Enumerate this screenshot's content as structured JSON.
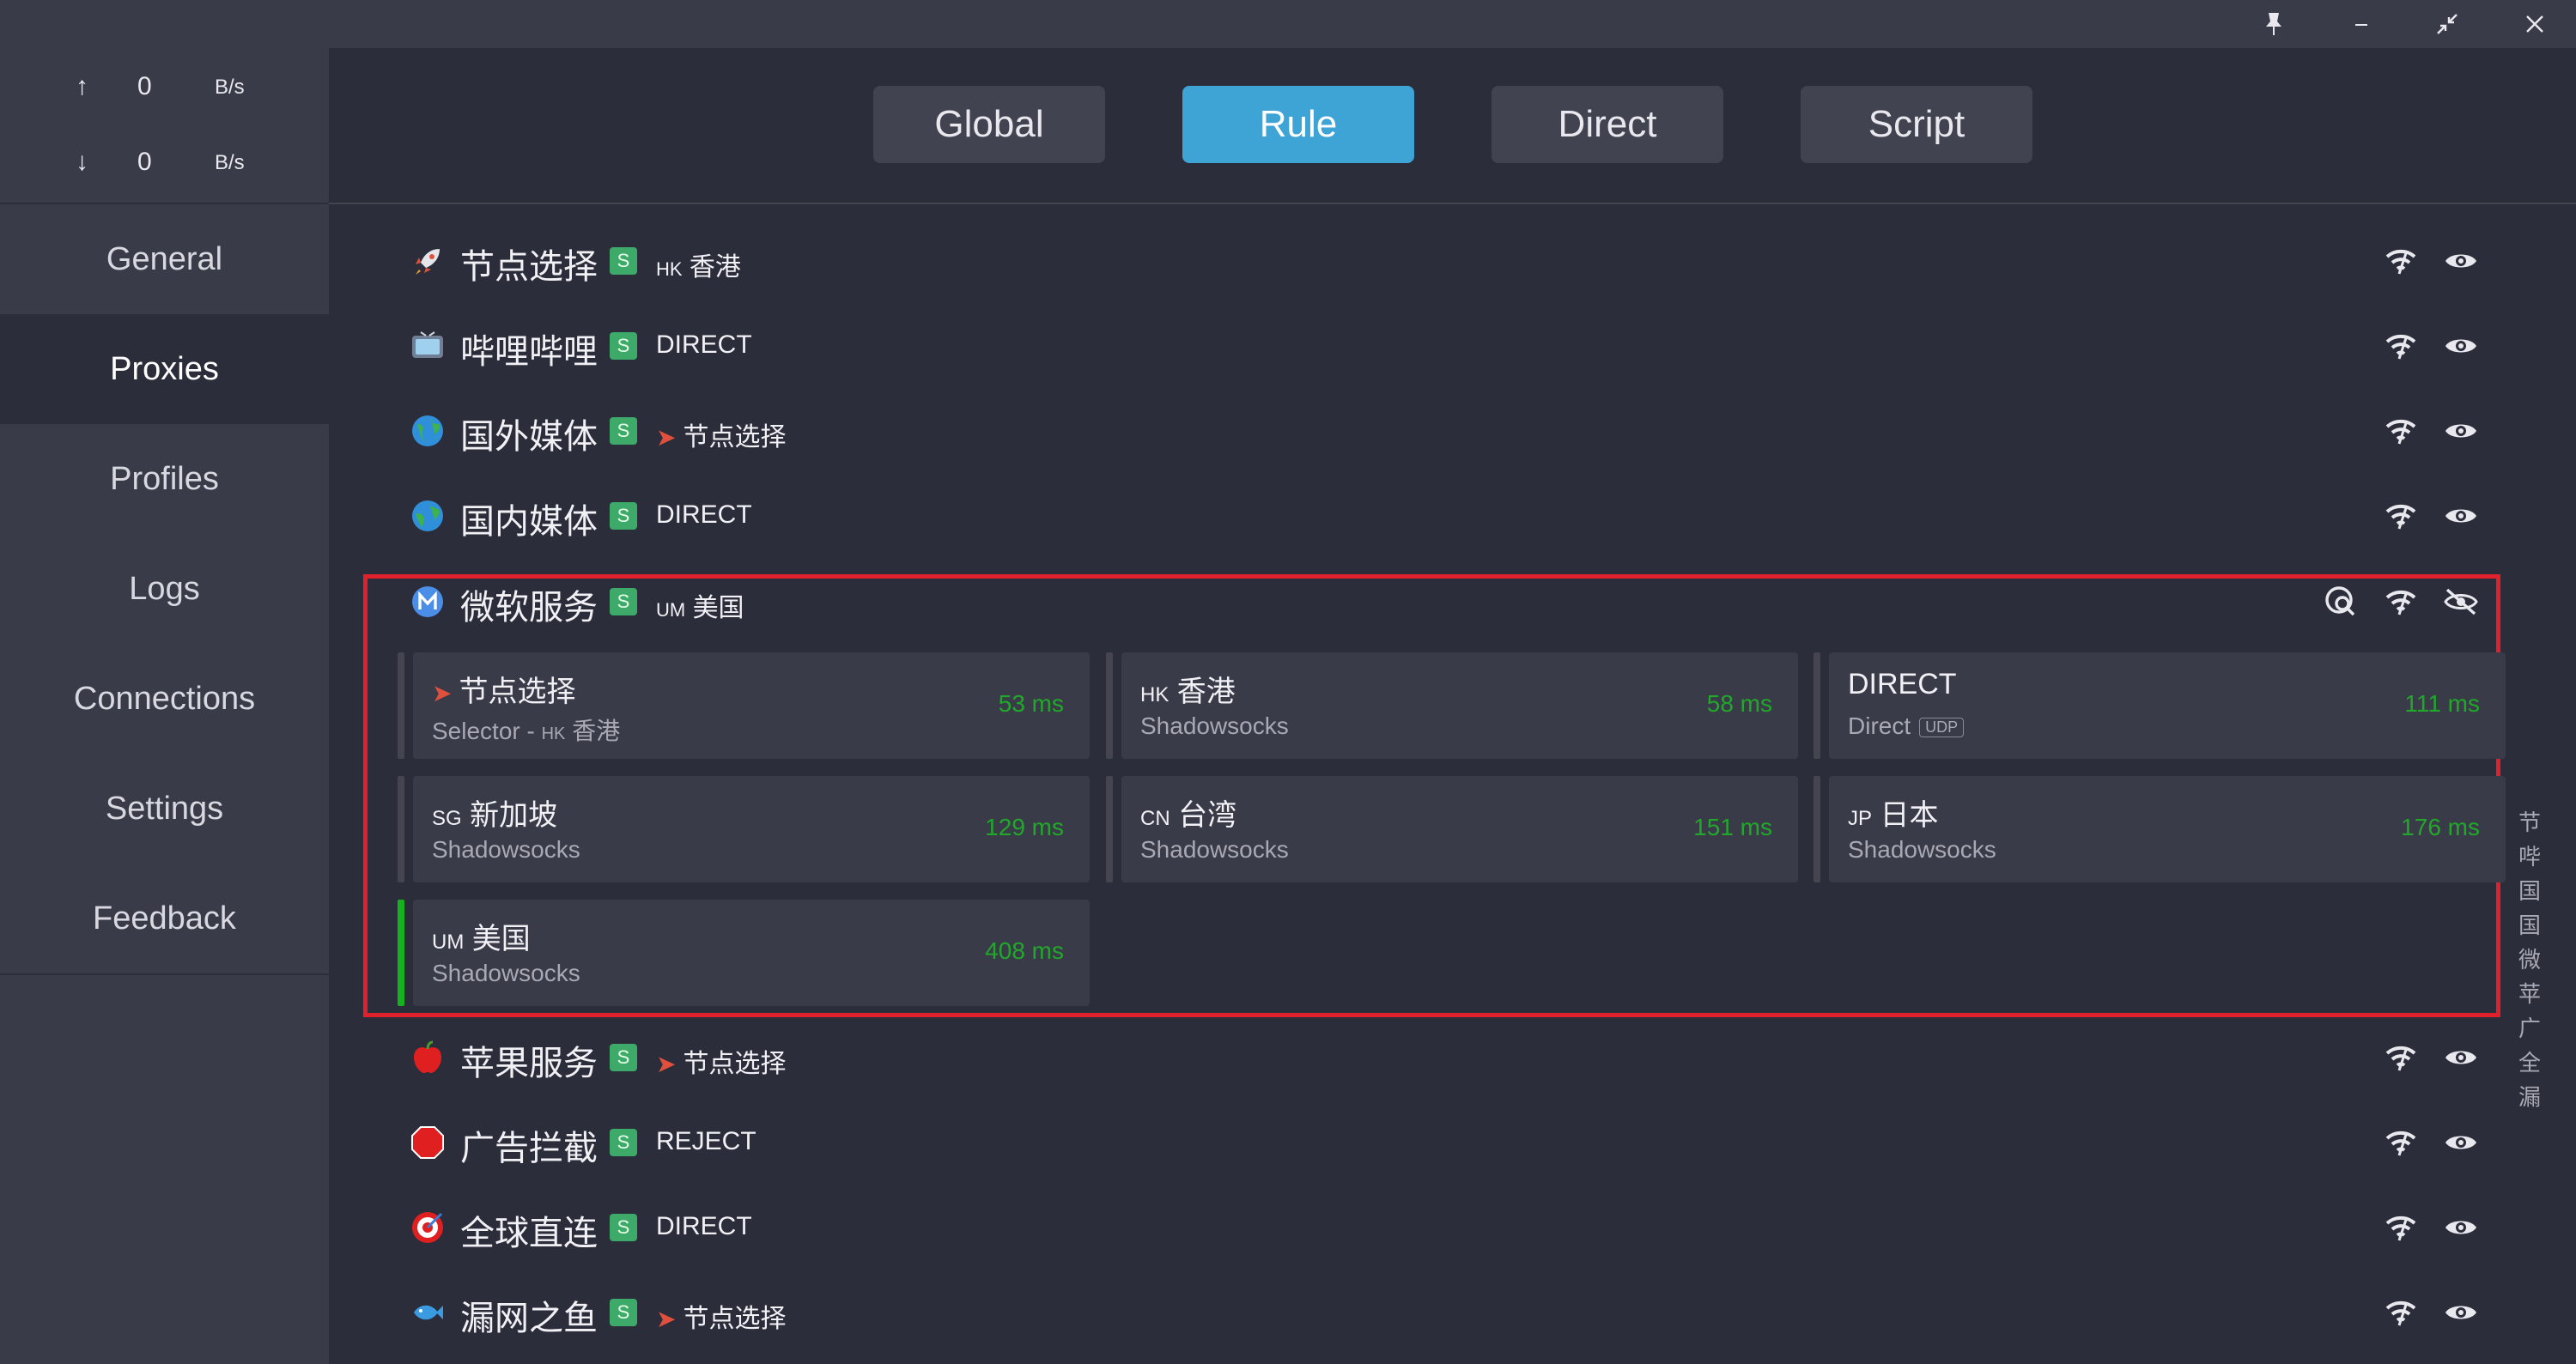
{
  "titlebar": {
    "pin": "pin-icon",
    "minimize": "minimize-icon",
    "restore": "restore-icon",
    "close": "close-icon"
  },
  "sidebar": {
    "upload": {
      "arrow": "↑",
      "value": "0",
      "unit": "B/s"
    },
    "download": {
      "arrow": "↓",
      "value": "0",
      "unit": "B/s"
    },
    "items": [
      {
        "label": "General"
      },
      {
        "label": "Proxies"
      },
      {
        "label": "Profiles"
      },
      {
        "label": "Logs"
      },
      {
        "label": "Connections"
      },
      {
        "label": "Settings"
      },
      {
        "label": "Feedback"
      }
    ],
    "active": "Proxies"
  },
  "modes": [
    {
      "label": "Global"
    },
    {
      "label": "Rule"
    },
    {
      "label": "Direct"
    },
    {
      "label": "Script"
    }
  ],
  "active_mode": "Rule",
  "groups": [
    {
      "icon": "rocket-icon",
      "name": "节点选择",
      "badge": "S",
      "cur_cc": "HK",
      "cur": "香港"
    },
    {
      "icon": "tv-icon",
      "name": "哔哩哔哩",
      "badge": "S",
      "cur_cc": "",
      "cur": "DIRECT"
    },
    {
      "icon": "globe-icon",
      "name": "国外媒体",
      "badge": "S",
      "cur_cc": "",
      "cur": "节点选择"
    },
    {
      "icon": "globe-icon",
      "name": "国内媒体",
      "badge": "S",
      "cur_cc": "",
      "cur": "DIRECT"
    },
    {
      "icon": "microsoft-icon",
      "name": "微软服务",
      "badge": "S",
      "cur_cc": "UM",
      "cur": "美国"
    },
    {
      "icon": "apple-icon",
      "name": "苹果服务",
      "badge": "S",
      "cur_cc": "",
      "cur": "节点选择"
    },
    {
      "icon": "stop-icon",
      "name": "广告拦截",
      "badge": "S",
      "cur_cc": "",
      "cur": "REJECT"
    },
    {
      "icon": "target-icon",
      "name": "全球直连",
      "badge": "S",
      "cur_cc": "",
      "cur": "DIRECT"
    },
    {
      "icon": "fish-icon",
      "name": "漏网之鱼",
      "badge": "S",
      "cur_cc": "",
      "cur": "节点选择"
    }
  ],
  "proxies": [
    {
      "cc": "",
      "name": "节点选择",
      "type": "Selector - ",
      "type_cc": "HK",
      "type_name": "香港",
      "latency": "53 ms"
    },
    {
      "cc": "HK",
      "name": "香港",
      "type": "Shadowsocks",
      "latency": "58 ms"
    },
    {
      "cc": "",
      "name": "DIRECT",
      "type": "Direct",
      "udp": "UDP",
      "latency": "111 ms"
    },
    {
      "cc": "SG",
      "name": "新加坡",
      "type": "Shadowsocks",
      "latency": "129 ms"
    },
    {
      "cc": "CN",
      "name": "台湾",
      "type": "Shadowsocks",
      "latency": "151 ms"
    },
    {
      "cc": "JP",
      "name": "日本",
      "type": "Shadowsocks",
      "latency": "176 ms"
    },
    {
      "cc": "UM",
      "name": "美国",
      "type": "Shadowsocks",
      "latency": "408 ms"
    }
  ],
  "quick_index": [
    "节",
    "哔",
    "国",
    "国",
    "微",
    "苹",
    "广",
    "全",
    "漏"
  ],
  "colors": {
    "accent": "#3ea4d6",
    "badge": "#3daa6a",
    "latency": "#21a82b",
    "selected": "#15b21f",
    "highlight": "#e0202a"
  }
}
